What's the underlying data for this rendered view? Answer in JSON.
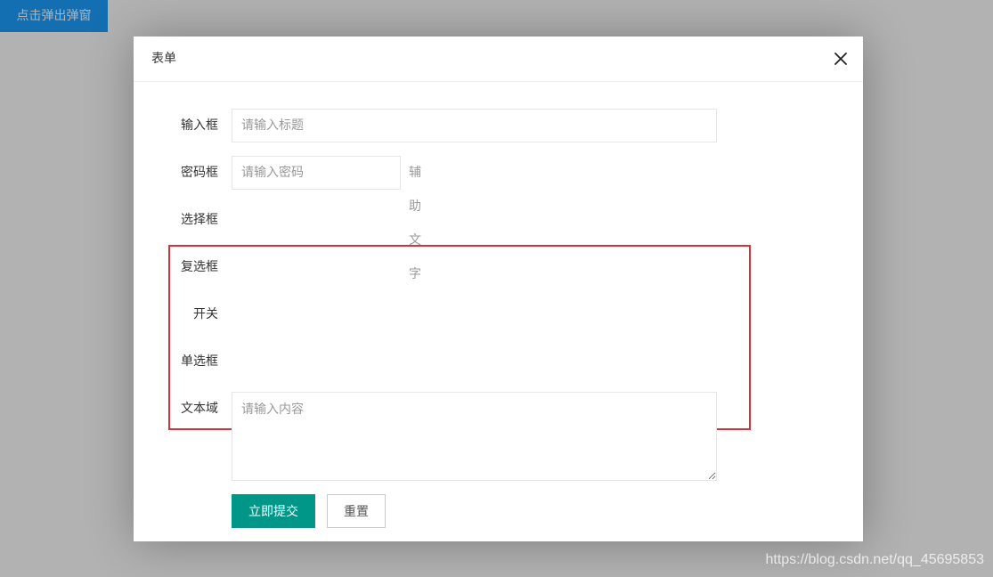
{
  "page": {
    "open_button_label": "点击弹出弹窗",
    "watermark": "https://blog.csdn.net/qq_45695853"
  },
  "modal": {
    "title": "表单",
    "close_icon": "close-icon"
  },
  "form": {
    "input": {
      "label": "输入框",
      "placeholder": "请输入标题",
      "value": ""
    },
    "password": {
      "label": "密码框",
      "placeholder": "请输入密码",
      "value": "",
      "aux_text": "辅助文字"
    },
    "select": {
      "label": "选择框"
    },
    "checkbox": {
      "label": "复选框"
    },
    "switch": {
      "label": "开关"
    },
    "radio": {
      "label": "单选框"
    },
    "textarea": {
      "label": "文本域",
      "placeholder": "请输入内容",
      "value": ""
    },
    "submit_label": "立即提交",
    "reset_label": "重置"
  },
  "colors": {
    "open_button": "#1e9fff",
    "submit_button": "#009688",
    "highlight_border": "#d9303a"
  }
}
